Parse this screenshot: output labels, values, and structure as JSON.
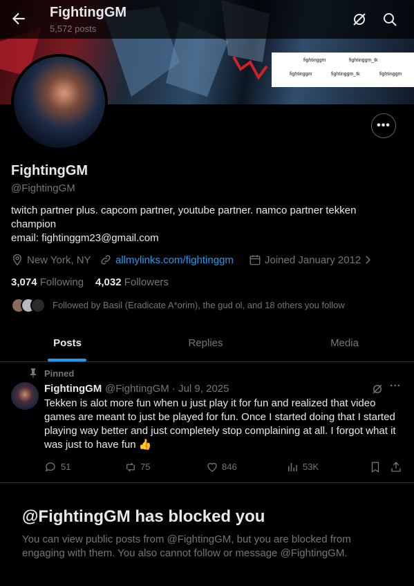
{
  "header": {
    "title": "FightingGM",
    "post_count": "5,572 posts",
    "icons": [
      "back-arrow-icon",
      "grok-icon",
      "search-icon"
    ]
  },
  "banner": {
    "socials": [
      "fightinggm",
      "fightinggm_tk",
      "fightinggm",
      "fightinggm_tk",
      "fightinggm"
    ]
  },
  "profile": {
    "name": "FightingGM",
    "handle": "@FightingGM",
    "bio": "twitch partner plus. capcom partner, youtube partner.  namco partner tekken champion\nemail: fightinggm23@gmail.com",
    "location": "New York, NY",
    "link": "allmylinks.com/fightinggm",
    "joined": "Joined January 2012",
    "following_count": "3,074",
    "following_label": "Following",
    "followers_count": "4,032",
    "followers_label": "Followers",
    "followed_by": "Followed by Basil (Eradicate A*orim), the gud ol, and 18 others you follow",
    "more_label": "•••"
  },
  "tabs": [
    {
      "label": "Posts",
      "active": true
    },
    {
      "label": "Replies",
      "active": false
    },
    {
      "label": "Media",
      "active": false
    }
  ],
  "pinned_post": {
    "pinned_label": "Pinned",
    "author": "FightingGM",
    "meta": "@FightingGM · Jul 9, 2025",
    "text": "Tekken is alot more fun when u just play it for fun and realized that video games are meant to just be played for fun. Once I started doing that I started playing way better and just completely  stop complaining at all. I forgot what it was just to have fun 👍",
    "more_label": "···",
    "replies": "51",
    "reposts": "75",
    "likes": "846",
    "views": "53K"
  },
  "blocked": {
    "title": "@FightingGM has blocked you",
    "description": "You can view public posts from @FightingGM, but you are blocked from engaging with them. You also cannot follow or message @FightingGM."
  },
  "colors": {
    "accent": "#1d9bf0",
    "muted": "#71767b",
    "text": "#e7e9ea",
    "border": "#2f3336"
  }
}
